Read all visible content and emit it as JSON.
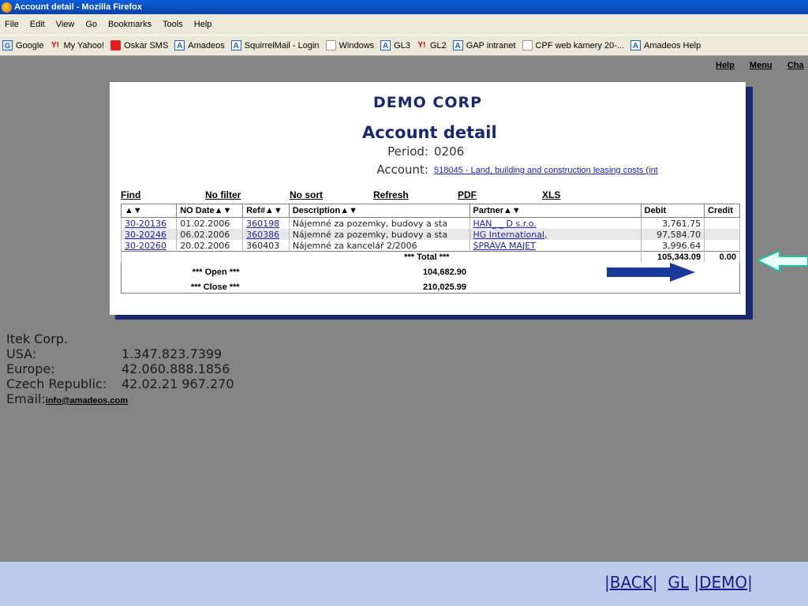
{
  "window": {
    "title": "Account detail - Mozilla Firefox"
  },
  "menu": [
    "File",
    "Edit",
    "View",
    "Go",
    "Bookmarks",
    "Tools",
    "Help"
  ],
  "bookmarks": [
    {
      "label": "Google",
      "icon": "google-icon"
    },
    {
      "label": "My Yahoo!",
      "icon": "yahoo-icon"
    },
    {
      "label": "Oskar SMS",
      "icon": "oskar-icon"
    },
    {
      "label": "Amadeos",
      "icon": "amadeos-icon"
    },
    {
      "label": "SquirrelMail - Login",
      "icon": "amadeos-icon"
    },
    {
      "label": "Windows",
      "icon": "document-icon"
    },
    {
      "label": "GL3",
      "icon": "amadeos-icon"
    },
    {
      "label": "GL2",
      "icon": "yahoo-icon"
    },
    {
      "label": "GAP intranet",
      "icon": "amadeos-icon"
    },
    {
      "label": "CPF web kamery 20-...",
      "icon": "document-icon"
    },
    {
      "label": "Amadeos Help",
      "icon": "amadeos-icon"
    }
  ],
  "top_links": [
    "Help",
    "Menu",
    "Cha"
  ],
  "report": {
    "company": "DEMO CORP",
    "title": "Account detail",
    "period_label": "Period:",
    "period_value": "0206",
    "account_label": "Account:",
    "account_value": "518045 - Land, building and construction leasing costs (int"
  },
  "actions": [
    "Find",
    "No filter",
    "No sort",
    "Refresh",
    "PDF",
    "XLS"
  ],
  "table": {
    "headers": [
      "▲▼",
      "NO Date▲▼",
      "Ref#▲▼",
      "Description▲▼",
      "Partner▲▼",
      "Debit",
      "Credit"
    ],
    "rows": [
      {
        "doc": "30-20136",
        "date": "01.02.2006",
        "ref": "360198",
        "desc": "Nájemné za pozemky, budovy a sta",
        "partner": "HAN_ _ D s.r.o.",
        "debit": "3,761.75",
        "credit": ""
      },
      {
        "doc": "30-20246",
        "date": "06.02.2006",
        "ref": "360386",
        "desc": "Nájemné za pozemky, budovy a sta",
        "partner": "HG International,",
        "debit": "97,584.70",
        "credit": ""
      },
      {
        "doc": "30-20260",
        "date": "20.02.2006",
        "ref": "360403",
        "desc": "Nájemné za kancelář 2/2006",
        "partner": "SPRÁVA MAJET",
        "debit": "3,996.64",
        "credit": ""
      }
    ],
    "total_label": "*** Total ***",
    "total_debit": "105,343.09",
    "total_credit": "0.00",
    "open_label": "*** Open ***",
    "open_value": "104,682.90",
    "close_label": "*** Close ***",
    "close_value": "210,025.99"
  },
  "contact": {
    "company": "Itek Corp.",
    "usa_label": "USA:",
    "usa": "1.347.823.7399",
    "europe_label": "Europe:",
    "europe": "42.060.888.1856",
    "cz_label": "Czech Republic:",
    "cz": "42.02.21 967.270",
    "email_label": "Email:",
    "email": "info@amadeos.com"
  },
  "footer": {
    "back": "BACK",
    "gl": "GL",
    "demo": "DEMO"
  },
  "colors": {
    "heading": "#1a2870",
    "blue_arrow": "#1a3a9a",
    "green_arrow": "#20c0a0",
    "footer_bg": "#b9cce9"
  }
}
